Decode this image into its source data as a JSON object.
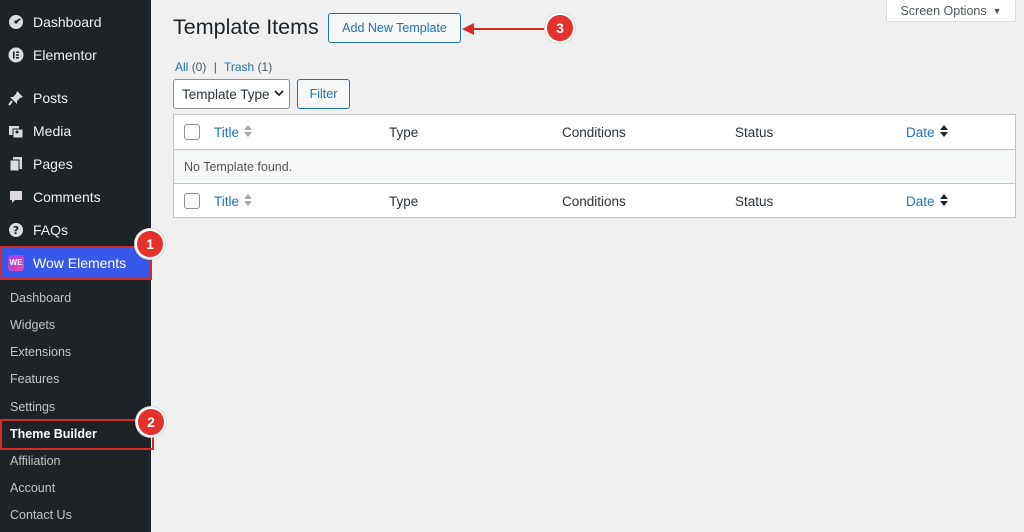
{
  "sidebar": {
    "menu": [
      {
        "label": "Dashboard",
        "icon": "dashboard-icon"
      },
      {
        "label": "Elementor",
        "icon": "elementor-icon"
      },
      {
        "label": "Posts",
        "icon": "pin-icon"
      },
      {
        "label": "Media",
        "icon": "media-icon"
      },
      {
        "label": "Pages",
        "icon": "pages-icon"
      },
      {
        "label": "Comments",
        "icon": "comment-icon"
      },
      {
        "label": "FAQs",
        "icon": "question-icon"
      },
      {
        "label": "Wow Elements",
        "icon": "wow-elements-icon",
        "logo_text": "WE"
      }
    ],
    "submenu": [
      "Dashboard",
      "Widgets",
      "Extensions",
      "Features",
      "Settings",
      "Theme Builder",
      "Affiliation",
      "Account",
      "Contact Us"
    ],
    "active_color": "#3858e9"
  },
  "header": {
    "title": "Template Items",
    "add_new_label": "Add New Template",
    "screen_options_label": "Screen Options"
  },
  "filters": {
    "all_label": "All",
    "all_count": "(0)",
    "separator": "|",
    "trash_label": "Trash",
    "trash_count": "(1)",
    "type_select_value": "Template Type",
    "filter_label": "Filter"
  },
  "table": {
    "columns": [
      "Title",
      "Type",
      "Conditions",
      "Status",
      "Date"
    ],
    "empty_message": "No Template found."
  },
  "annotations": {
    "badges": [
      "1",
      "2",
      "3"
    ],
    "highlight_color": "#d62b2b"
  }
}
